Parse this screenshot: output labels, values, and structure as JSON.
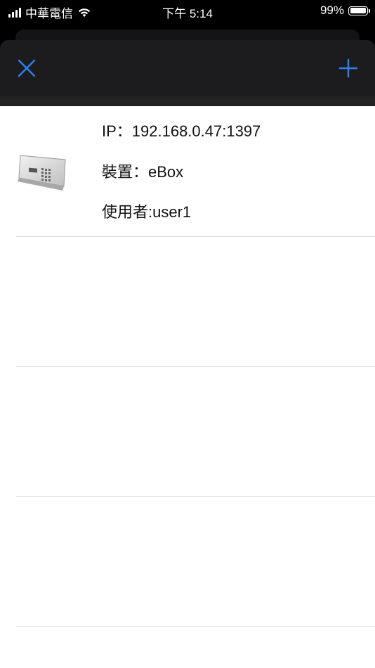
{
  "status_bar": {
    "carrier": "中華電信",
    "time": "下午 5:14",
    "battery_percent": "99%",
    "battery_level": 0.99
  },
  "nav": {
    "close_icon": "close-icon",
    "add_icon": "plus-icon",
    "accent_color": "#2f80ed"
  },
  "devices": [
    {
      "ip": "IP：192.168.0.47:1397",
      "device": "裝置：eBox",
      "user": "使用者:user1",
      "image": "ebox-device-icon"
    }
  ]
}
